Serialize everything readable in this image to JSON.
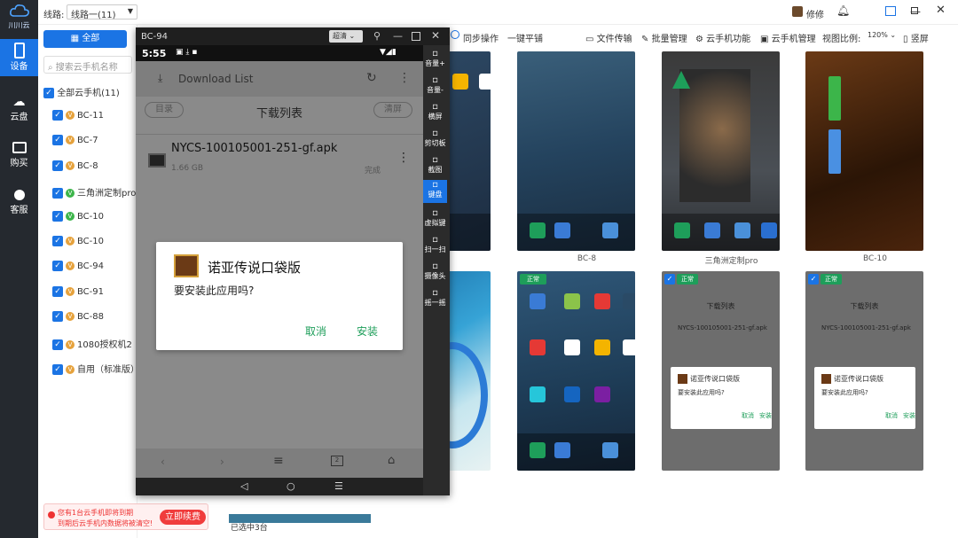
{
  "nav": {
    "logo": "川川云",
    "items": [
      "设备",
      "云盘",
      "购买",
      "客服"
    ]
  },
  "topbar": {
    "route_label": "线路:",
    "route_value": "线路一(11)",
    "username": "修修"
  },
  "left": {
    "all_button": "全部",
    "search_placeholder": "搜索云手机名称",
    "all_label": "全部云手机(11)",
    "devices": [
      "BC-11",
      "BC-7",
      "BC-8",
      "三角洲定制pro",
      "BC-10",
      "BC-10",
      "BC-94",
      "BC-91",
      "BC-88",
      "1080授权机2",
      "自用（标准版）"
    ],
    "promo_text1": "您有1台云手机即将到期",
    "promo_text2": "到期后云手机内数据将被清空!",
    "promo_button": "立即续费"
  },
  "toolbar": {
    "sync": "同步操作",
    "one_key": "一键平铺",
    "file_transfer": "文件传输",
    "batch": "批量管理",
    "cloud_func": "云手机功能",
    "cloud_manage": "云手机管理",
    "view_ratio_label": "视图比例:",
    "view_ratio": "120%",
    "vertical": "竖屏"
  },
  "window": {
    "title": "BC-94",
    "quality": "超清",
    "time": "5:55",
    "app_title": "Download List",
    "tab_left": "目录",
    "tab_center": "下载列表",
    "tab_right": "清屏",
    "file_name": "NYCS-100105001-251-gf.apk",
    "file_size": "1.66 GB",
    "file_status": "完成",
    "dialog_title": "诺亚传说口袋版",
    "dialog_text": "要安装此应用吗?",
    "dialog_cancel": "取消",
    "dialog_install": "安装"
  },
  "rightbar": [
    "音量+",
    "音量-",
    "横屏",
    "剪切板",
    "截图",
    "键盘",
    "虚拟键",
    "扫一扫",
    "摄像头",
    "摇一摇"
  ],
  "grid": {
    "labels": [
      "BC-8",
      "三角洲定制pro",
      "BC-10"
    ],
    "status": "正常",
    "icons_row1": [
      "通知栏",
      "文件",
      "系统相册",
      "OpenGames"
    ],
    "icons_row2": [
      "设置",
      "Search",
      "相册服务",
      "X浏览器"
    ],
    "icons_row3": [
      "应用市场",
      "Wander",
      "UBChunker"
    ],
    "mini_header": "下载列表",
    "mini_file": "NYCS-100105001-251-gf.apk",
    "mini_dialog_title": "诺亚传说口袋版",
    "mini_dialog_text": "要安装此应用吗?",
    "mini_cancel": "取消",
    "mini_install": "安装",
    "selected": "已选中3台"
  }
}
